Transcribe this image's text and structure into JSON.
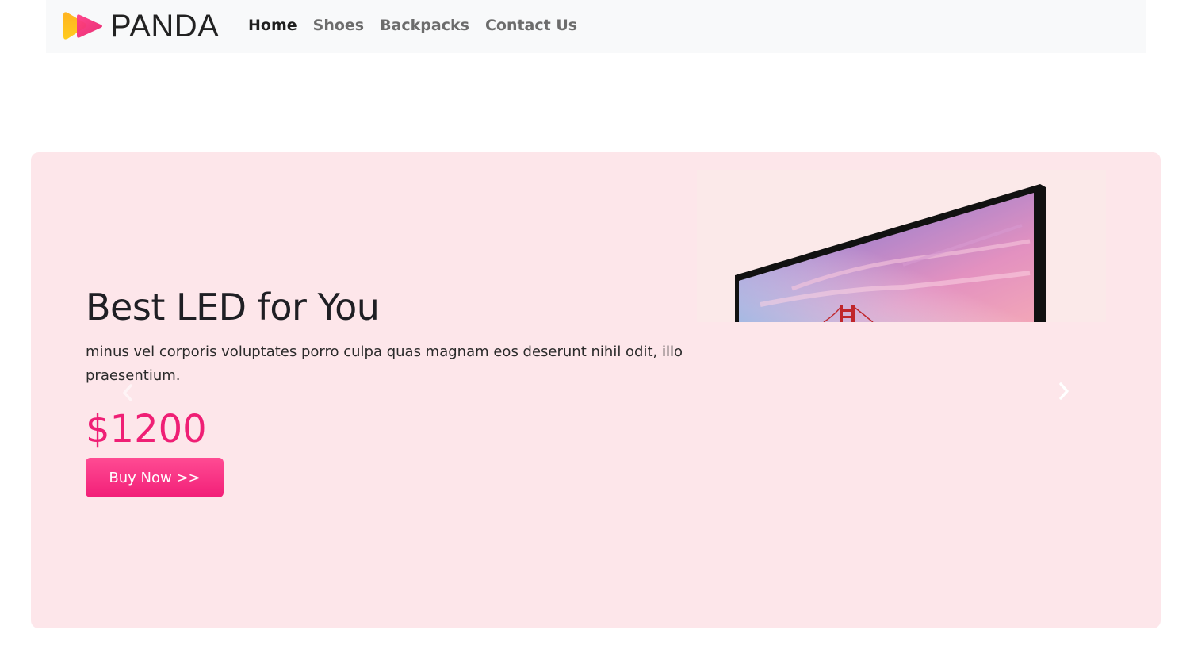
{
  "brand": {
    "name": "PANDA",
    "icon": "play-arrows-logo"
  },
  "nav": {
    "items": [
      {
        "label": "Home",
        "active": true
      },
      {
        "label": "Shoes",
        "active": false
      },
      {
        "label": "Backpacks",
        "active": false
      },
      {
        "label": "Contact Us",
        "active": false
      }
    ]
  },
  "hero": {
    "title": "Best LED for You",
    "description": "minus vel corporis voluptates porro culpa quas magnam eos deserunt nihil odit, illo praesentium.",
    "price": "$1200",
    "button_label": "Buy Now >>",
    "image": "led-monitor-golden-gate-bridge",
    "prev_icon": "chevron-left-icon",
    "next_icon": "chevron-right-icon"
  },
  "colors": {
    "hero_background": "#fde6ea",
    "accent": "#ef1f75",
    "navbar_background": "#f8f9fa"
  }
}
